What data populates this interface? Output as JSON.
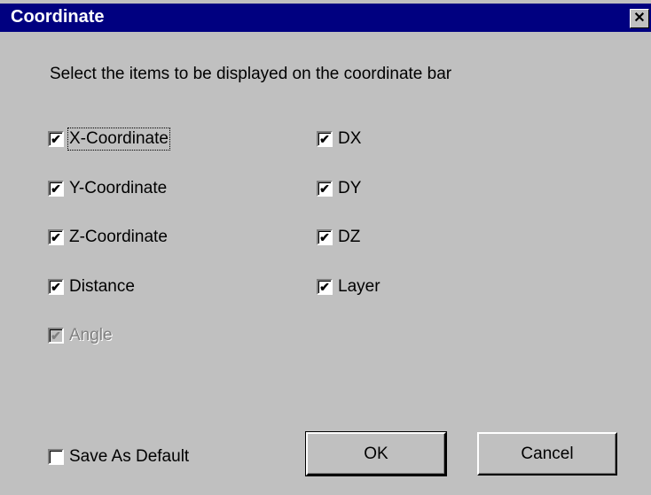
{
  "window": {
    "title": "Coordinate",
    "close_glyph": "✕"
  },
  "instruction": "Select the items to be displayed on the coordinate bar",
  "checkboxes": {
    "x_coordinate": {
      "label": "X-Coordinate",
      "checked": true,
      "mark": "✔"
    },
    "y_coordinate": {
      "label": "Y-Coordinate",
      "checked": true,
      "mark": "✔"
    },
    "z_coordinate": {
      "label": "Z-Coordinate",
      "checked": true,
      "mark": "✔"
    },
    "distance": {
      "label": "Distance",
      "checked": true,
      "mark": "✔"
    },
    "angle": {
      "label": "Angle",
      "checked": true,
      "disabled": true,
      "mark": "✔"
    },
    "dx": {
      "label": "DX",
      "checked": true,
      "mark": "✔"
    },
    "dy": {
      "label": "DY",
      "checked": true,
      "mark": "✔"
    },
    "dz": {
      "label": "DZ",
      "checked": true,
      "mark": "✔"
    },
    "layer": {
      "label": "Layer",
      "checked": true,
      "mark": "✔"
    },
    "save_as_default": {
      "label": "Save As Default",
      "checked": false,
      "mark": ""
    }
  },
  "buttons": {
    "ok": "OK",
    "cancel": "Cancel"
  },
  "icons": {
    "close": "close-icon",
    "check": "checkmark-icon"
  },
  "colors": {
    "titlebar": "#000080",
    "dialog_bg": "#c0c0c0"
  }
}
